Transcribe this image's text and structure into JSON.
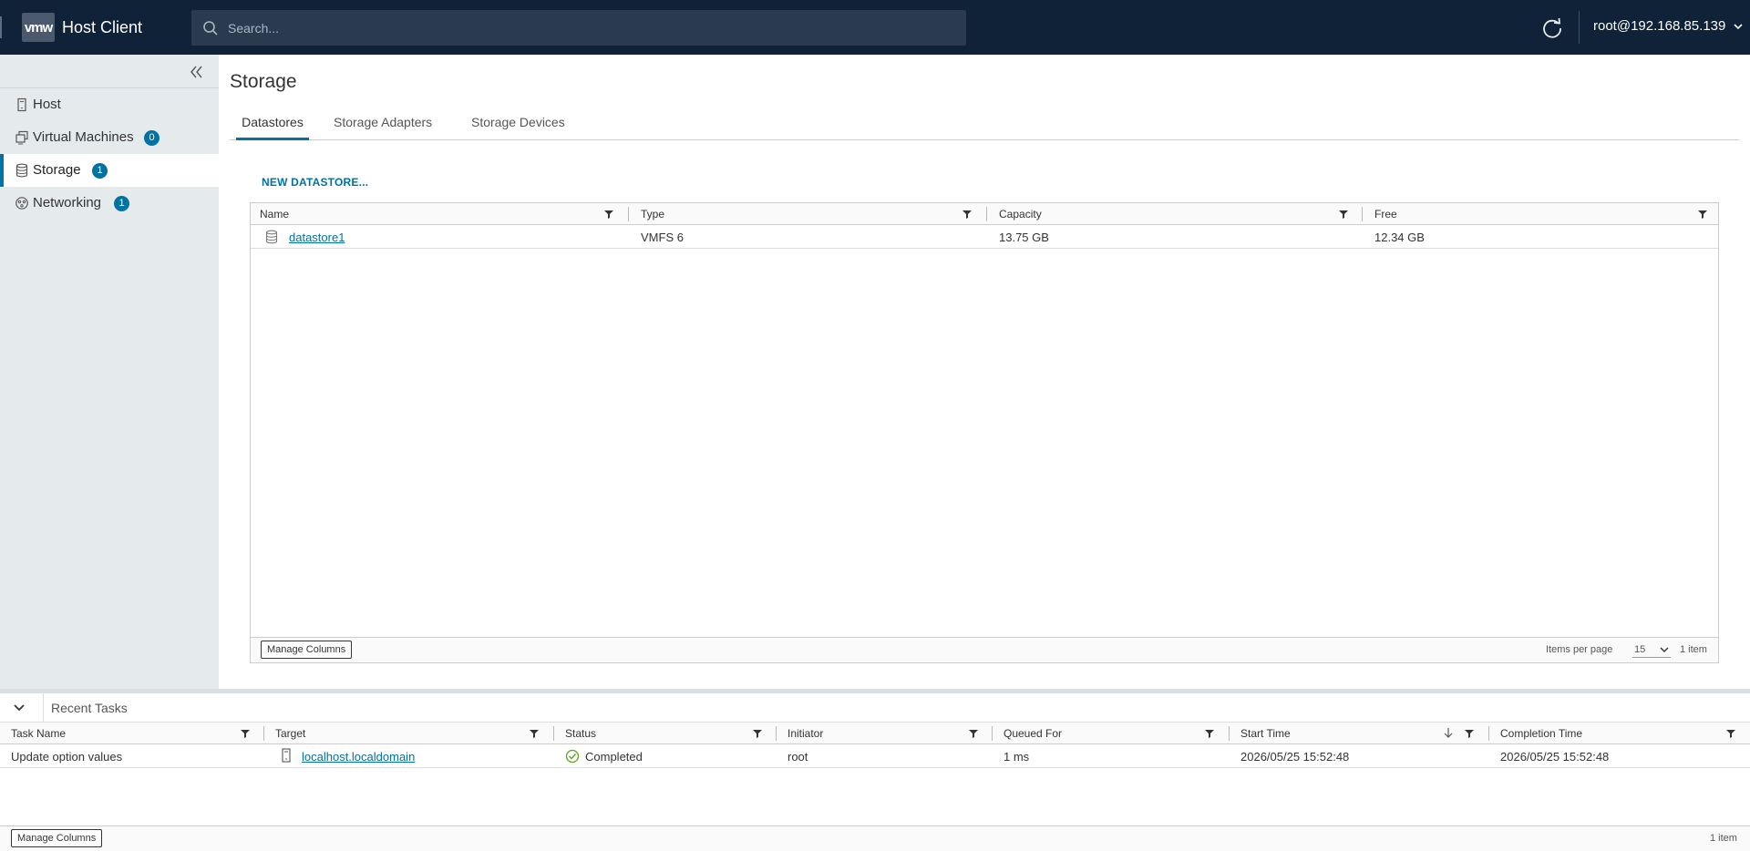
{
  "header": {
    "logo": "vmw",
    "app_title": "Host Client",
    "search_placeholder": "Search...",
    "user": "root@192.168.85.139"
  },
  "sidebar": {
    "items": [
      {
        "label": "Host",
        "icon": "host-icon"
      },
      {
        "label": "Virtual Machines",
        "icon": "vm-icon",
        "badge": "0"
      },
      {
        "label": "Storage",
        "icon": "storage-icon",
        "badge": "1",
        "active": true
      },
      {
        "label": "Networking",
        "icon": "network-icon",
        "badge": "1"
      }
    ]
  },
  "main": {
    "title": "Storage",
    "tabs": [
      {
        "label": "Datastores",
        "active": true
      },
      {
        "label": "Storage Adapters"
      },
      {
        "label": "Storage Devices"
      }
    ],
    "new_datastore": "NEW DATASTORE...",
    "grid": {
      "columns": [
        "Name",
        "Type",
        "Capacity",
        "Free"
      ],
      "rows": [
        {
          "name": "datastore1",
          "type": "VMFS 6",
          "capacity": "13.75 GB",
          "free": "12.34 GB"
        }
      ],
      "manage_columns": "Manage Columns",
      "items_per_page_label": "Items per page",
      "items_per_page": "15",
      "count": "1 item"
    }
  },
  "tasks": {
    "title": "Recent Tasks",
    "columns": [
      "Task Name",
      "Target",
      "Status",
      "Initiator",
      "Queued For",
      "Start Time",
      "Completion Time"
    ],
    "rows": [
      {
        "task": "Update option values",
        "target": "localhost.localdomain",
        "status": "Completed",
        "initiator": "root",
        "queued": "1 ms",
        "start": "2026/05/25 15:52:48",
        "completion": "2026/05/25 15:52:48"
      }
    ],
    "manage_columns": "Manage Columns",
    "count": "1 item"
  },
  "colors": {
    "header_bg": "#0f2238",
    "accent": "#0072a3",
    "success": "#5aa220"
  }
}
